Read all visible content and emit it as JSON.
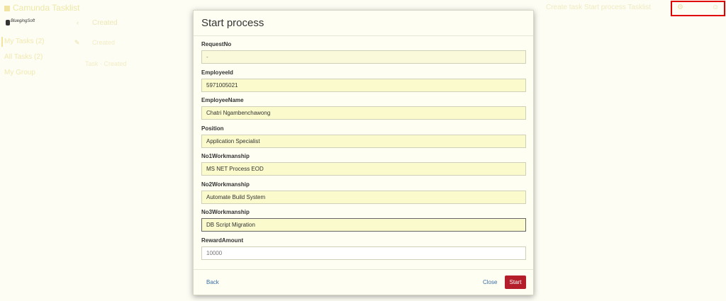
{
  "background": {
    "app_title": "Camunda Tasklist",
    "company_logo_text": "BluegingSoft",
    "top_right_text": "Create task   Start process   Tasklist",
    "sidebar_items": [
      "My Tasks (2)",
      "All Tasks (2)",
      "My Group"
    ],
    "filter_label": "Created",
    "column_a": "Created",
    "column_b": "Task · Created"
  },
  "modal": {
    "title": "Start process",
    "fields": [
      {
        "label": "RequestNo",
        "value": "-"
      },
      {
        "label": "EmployeeId",
        "value": "5971005021"
      },
      {
        "label": "EmployeeName",
        "value": "Chatri Ngambenchawong"
      },
      {
        "label": "Position",
        "value": "Application Specialist"
      },
      {
        "label": "No1Workmanship",
        "value": "MS NET Process EOD"
      },
      {
        "label": "No2Workmanship",
        "value": "Automate Build System"
      },
      {
        "label": "No3Workmanship",
        "value": "DB Script Migration"
      },
      {
        "label": "RewardAmount",
        "value": "10000"
      }
    ],
    "back_label": "Back",
    "close_label": "Close",
    "start_label": "Start"
  },
  "colors": {
    "accent": "#b41e2b",
    "link": "#3a6ea5",
    "input_bg": "#fafacc",
    "highlight_box": "#e00000"
  }
}
